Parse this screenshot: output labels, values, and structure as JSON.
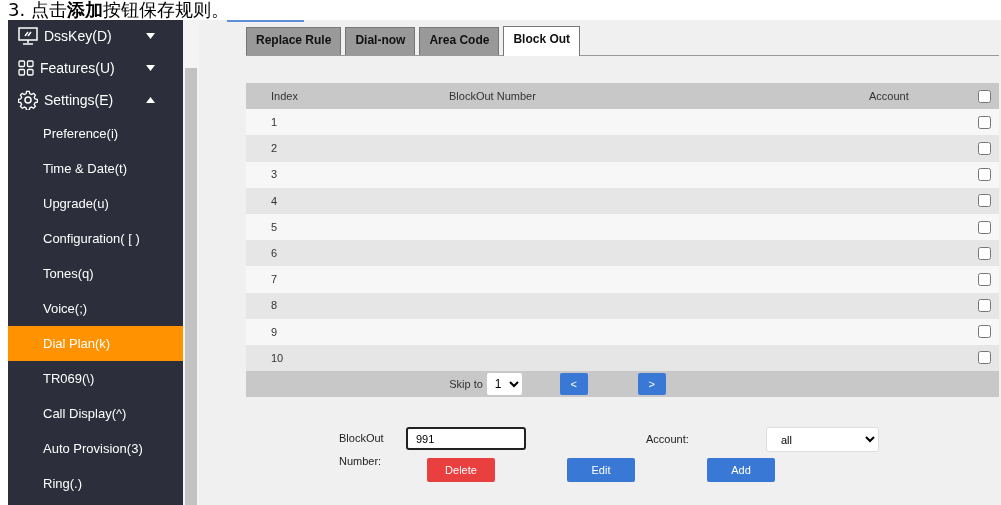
{
  "caption": "3. 点击**添加**按钮保存规则。",
  "sidebar": {
    "items": [
      {
        "label": "DssKey(D)",
        "expanded": false
      },
      {
        "label": "Features(U)",
        "expanded": false
      },
      {
        "label": "Settings(E)",
        "expanded": true,
        "children": [
          {
            "label": "Preference(i)",
            "selected": false
          },
          {
            "label": "Time & Date(t)",
            "selected": false
          },
          {
            "label": "Upgrade(u)",
            "selected": false
          },
          {
            "label": "Configuration( [ )",
            "selected": false
          },
          {
            "label": "Tones(q)",
            "selected": false
          },
          {
            "label": "Voice(;)",
            "selected": false
          },
          {
            "label": "Dial Plan(k)",
            "selected": true
          },
          {
            "label": "TR069(\\)",
            "selected": false
          },
          {
            "label": "Call Display(^)",
            "selected": false
          },
          {
            "label": "Auto Provision(3)",
            "selected": false
          },
          {
            "label": "Ring(.)",
            "selected": false
          }
        ]
      }
    ]
  },
  "tabs": [
    {
      "label": "Replace Rule",
      "selected": false
    },
    {
      "label": "Dial-now",
      "selected": false
    },
    {
      "label": "Area Code",
      "selected": false
    },
    {
      "label": "Block Out",
      "selected": true
    }
  ],
  "table": {
    "columns": [
      "Index",
      "BlockOut Number",
      "Account"
    ],
    "select_all_checked": false,
    "rows": [
      {
        "index": "1",
        "checked": false
      },
      {
        "index": "2",
        "checked": false
      },
      {
        "index": "3",
        "checked": false
      },
      {
        "index": "4",
        "checked": false
      },
      {
        "index": "5",
        "checked": false
      },
      {
        "index": "6",
        "checked": false
      },
      {
        "index": "7",
        "checked": false
      },
      {
        "index": "8",
        "checked": false
      },
      {
        "index": "9",
        "checked": false
      },
      {
        "index": "10",
        "checked": false
      }
    ]
  },
  "pager": {
    "skip_label": "Skip to",
    "page": "1",
    "prev": "<",
    "next": ">"
  },
  "form": {
    "number_label": "BlockOut Number:",
    "number_value": "991",
    "account_label": "Account:",
    "account_value": "all",
    "buttons": [
      {
        "label": "Delete",
        "kind": "danger"
      },
      {
        "label": "Edit",
        "kind": "primary"
      },
      {
        "label": "Add",
        "kind": "primary"
      }
    ]
  }
}
